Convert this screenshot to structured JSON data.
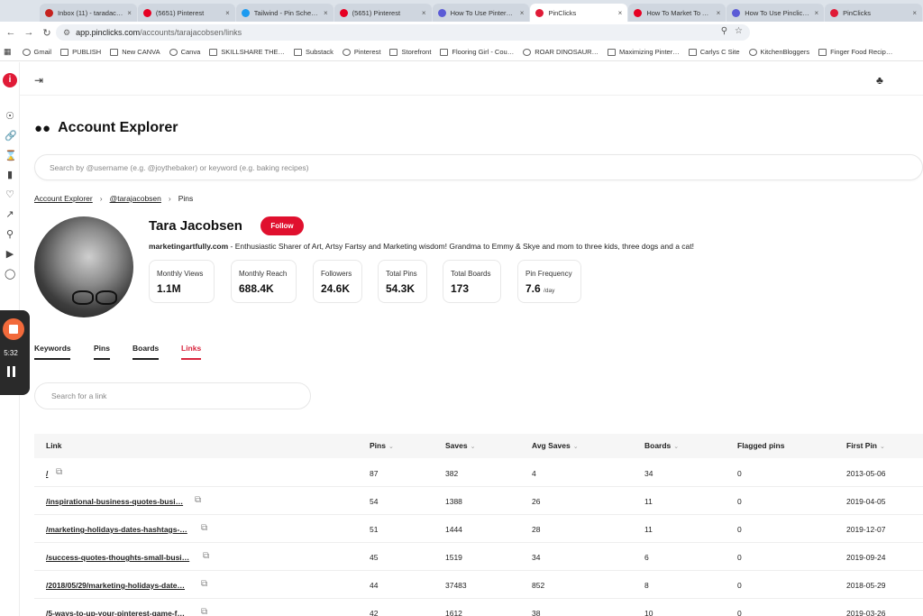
{
  "browser": {
    "tabs": [
      {
        "title": "Inbox (11) - taradact…",
        "color": "#c5221f",
        "active": false
      },
      {
        "title": "(5651) Pinterest",
        "color": "#e60023",
        "active": false
      },
      {
        "title": "Tailwind - Pin Schedu…",
        "color": "#1d9bf0",
        "active": false
      },
      {
        "title": "(5651) Pinterest",
        "color": "#e60023",
        "active": false
      },
      {
        "title": "How To Use Pinterest…",
        "color": "#5b5bd6",
        "active": false
      },
      {
        "title": "PinClicks",
        "color": "#e01b37",
        "active": true
      },
      {
        "title": "How To Market To A…",
        "color": "#e60023",
        "active": false
      },
      {
        "title": "How To Use Pinclicks…",
        "color": "#5b5bd6",
        "active": false
      },
      {
        "title": "PinClicks",
        "color": "#e01b37",
        "active": false
      }
    ],
    "url_host": "app.pinclicks.com",
    "url_path": "/accounts/tarajacobsen/links",
    "bookmarks": [
      "Gmail",
      "PUBLISH",
      "New CANVA",
      "Canva",
      "SKILLSHARE THE…",
      "Substack",
      "Pinterest",
      "Storefront",
      "Flooring Girl - Cou…",
      "ROAR DINOSAUR…",
      "Maximizing Pinter…",
      "Carlys C Site",
      "KitchenBloggers",
      "Finger Food Recip…"
    ]
  },
  "recorder": {
    "time": "5:32"
  },
  "page": {
    "title": "Account Explorer",
    "search_placeholder": "Search by @username (e.g. @joythebaker) or keyword (e.g. baking recipes)",
    "breadcrumb": [
      "Account Explorer",
      "@tarajacobsen",
      "Pins"
    ]
  },
  "profile": {
    "name": "Tara Jacobsen",
    "follow_label": "Follow",
    "website": "marketingartfully.com",
    "bio": " - Enthusiastic Sharer of Art, Artsy Fartsy and Marketing wisdom! Grandma to Emmy & Skye and mom to three kids, three dogs and a cat!",
    "stats": [
      {
        "label": "Monthly Views",
        "value": "1.1M",
        "unit": ""
      },
      {
        "label": "Monthly Reach",
        "value": "688.4K",
        "unit": ""
      },
      {
        "label": "Followers",
        "value": "24.6K",
        "unit": ""
      },
      {
        "label": "Total Pins",
        "value": "54.3K",
        "unit": ""
      },
      {
        "label": "Total Boards",
        "value": "173",
        "unit": ""
      },
      {
        "label": "Pin Frequency",
        "value": "7.6",
        "unit": "/day"
      }
    ]
  },
  "tabs": [
    "Keywords",
    "Pins",
    "Boards",
    "Links"
  ],
  "active_tab": "Links",
  "link_search_placeholder": "Search for a link",
  "table": {
    "columns": [
      "Link",
      "Pins",
      "Saves",
      "Avg Saves",
      "Boards",
      "Flagged pins",
      "First Pin"
    ],
    "rows": [
      [
        "/",
        "87",
        "382",
        "4",
        "34",
        "0",
        "2013-05-06"
      ],
      [
        "/inspirational-business-quotes-busi…",
        "54",
        "1388",
        "26",
        "11",
        "0",
        "2019-04-05"
      ],
      [
        "/marketing-holidays-dates-hashtags-…",
        "51",
        "1444",
        "28",
        "11",
        "0",
        "2019-12-07"
      ],
      [
        "/success-quotes-thoughts-small-busi…",
        "45",
        "1519",
        "34",
        "6",
        "0",
        "2019-09-24"
      ],
      [
        "/2018/05/29/marketing-holidays-date…",
        "44",
        "37483",
        "852",
        "8",
        "0",
        "2018-05-29"
      ],
      [
        "/5-ways-to-up-your-pinterest-game-f…",
        "42",
        "1612",
        "38",
        "10",
        "0",
        "2019-03-26"
      ]
    ]
  }
}
